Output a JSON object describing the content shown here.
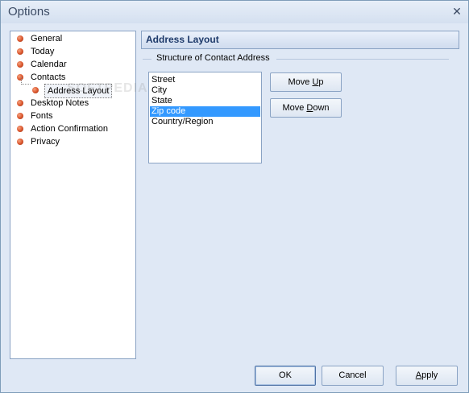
{
  "window": {
    "title": "Options",
    "close_symbol": "✕"
  },
  "tree": {
    "items": [
      {
        "label": "General"
      },
      {
        "label": "Today"
      },
      {
        "label": "Calendar"
      },
      {
        "label": "Contacts"
      },
      {
        "label": "Address Layout"
      },
      {
        "label": "Desktop Notes"
      },
      {
        "label": "Fonts"
      },
      {
        "label": "Action Confirmation"
      },
      {
        "label": "Privacy"
      }
    ],
    "selected": "Address Layout"
  },
  "section": {
    "title": "Address Layout"
  },
  "group": {
    "label": "Structure of Contact Address"
  },
  "address_fields": {
    "items": [
      "Street",
      "City",
      "State",
      "Zip code",
      "Country/Region"
    ],
    "selected": "Zip code"
  },
  "buttons": {
    "move_up": {
      "before": "Move ",
      "mnemonic": "U",
      "after": "p"
    },
    "move_down": {
      "before": "Move ",
      "mnemonic": "D",
      "after": "own"
    },
    "ok": "OK",
    "cancel": "Cancel",
    "apply": {
      "before": "",
      "mnemonic": "A",
      "after": "pply"
    }
  },
  "watermark": "SOFTPEDIA",
  "colors": {
    "selection": "#3399ff",
    "window_bg": "#dfe8f5",
    "header_text": "#1e3a6a"
  }
}
